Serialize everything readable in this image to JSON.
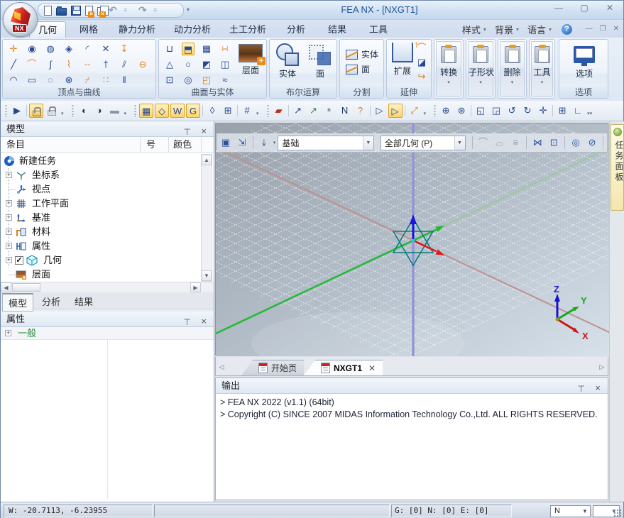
{
  "window": {
    "title": "FEA NX - [NXGT1]"
  },
  "colors": {
    "highlight": "#fbd46a",
    "accent_orange": "#e0801a",
    "accent_navy": "#27478f",
    "title_text": "#1f5494"
  },
  "ribbon": {
    "tabs": [
      "几何",
      "网格",
      "静力分析",
      "动力分析",
      "土工分析",
      "分析",
      "结果",
      "工具"
    ],
    "active_tab": "几何",
    "right_menus": [
      "样式",
      "背景",
      "语言"
    ],
    "groups": {
      "vertex_curve": {
        "label": "顶点与曲线"
      },
      "surface_solid": {
        "label": "曲面与实体",
        "button": "层面"
      },
      "boolean": {
        "label": "布尔运算",
        "b1": "实体",
        "b2": "面"
      },
      "divide": {
        "label": "分割",
        "b1": "实体",
        "b2": "面"
      },
      "extend": {
        "label": "延伸",
        "button": "扩展"
      },
      "transform": {
        "label": "转换"
      },
      "subshape": {
        "label": "子形状"
      },
      "delete": {
        "label": "删除"
      },
      "tools": {
        "label": "工具"
      },
      "options": {
        "label": "选项",
        "button": "选项"
      }
    },
    "icons": {
      "g1r1": [
        "point",
        "circle-center",
        "blob",
        "diamond-point",
        "fillet",
        "intersect",
        "project"
      ],
      "g1r2": [
        "line",
        "polyline",
        "spline",
        "coil",
        "dash-line",
        "axis-line",
        "offset",
        "arc-ellipse"
      ],
      "g1r3": [
        "arc",
        "rectangle",
        "cloud",
        "circle-cross",
        "trim",
        "two-point",
        "divide-bars"
      ],
      "g2r1": [
        "cylinder",
        "*box",
        "checker",
        "face-points"
      ],
      "g2r2": [
        "cone",
        "sphere",
        "solid-face",
        "sweep"
      ],
      "g2r3": [
        "cube",
        "torus",
        "fillet-solid",
        "surface-wave"
      ]
    }
  },
  "toolbar": {
    "groups": [
      [
        "run",
        "|",
        "*unlock",
        "lock",
        "v"
      ],
      [
        "view-solid",
        "view-mid",
        "view-off",
        "v"
      ],
      [
        "*grid",
        "*workplane",
        "*ruler-w",
        "*ruler-g",
        "|",
        "snap-plane",
        "snap-ucs",
        "|",
        "snap-grid",
        "v"
      ],
      [
        "surface-red",
        "|",
        "axis-a",
        "axis-e",
        "node-n",
        "elem-n",
        "elem-q",
        "|",
        "mesh-a",
        "*mesh-b",
        "|",
        "measure",
        "v"
      ],
      [
        "zoom-in",
        "zoom-net",
        "|",
        "zoom-window",
        "zoom-dyn",
        "rotate-ccw",
        "rotate-cw",
        "pan",
        "|",
        "quad-view",
        "ucs-box",
        "vv"
      ]
    ]
  },
  "model": {
    "title": "模型",
    "columns": [
      "条目",
      "号",
      "颜色"
    ],
    "tree": [
      {
        "label": "新建任务"
      },
      {
        "label": "坐标系"
      },
      {
        "label": "视点"
      },
      {
        "label": "工作平面"
      },
      {
        "label": "基准"
      },
      {
        "label": "材料"
      },
      {
        "label": "属性"
      },
      {
        "label": "几何"
      },
      {
        "label": "层面"
      }
    ],
    "tabs": [
      "模型",
      "分析",
      "结果"
    ]
  },
  "properties": {
    "title": "属性",
    "item": "一般"
  },
  "viewport": {
    "combo_workplane": "基础",
    "combo_filter": "全部几何 (P)",
    "triad": {
      "x": "X",
      "y": "Y",
      "z": "Z"
    },
    "task_panel": "任务面板"
  },
  "doc_tabs": [
    {
      "label": "开始页"
    },
    {
      "label": "NXGT1",
      "active": true
    }
  ],
  "output": {
    "title": "输出",
    "lines": [
      "> FEA NX 2022 (v1.1) (64bit)",
      "> Copyright (C) SINCE 2007 MIDAS Information Technology Co.,Ltd. ALL RIGHTS RESERVED."
    ]
  },
  "status": {
    "coords": "W: -20.7113,  -6.23955",
    "counts": "G: [0]  N: [0]  E: [0]",
    "combo1": "N"
  }
}
